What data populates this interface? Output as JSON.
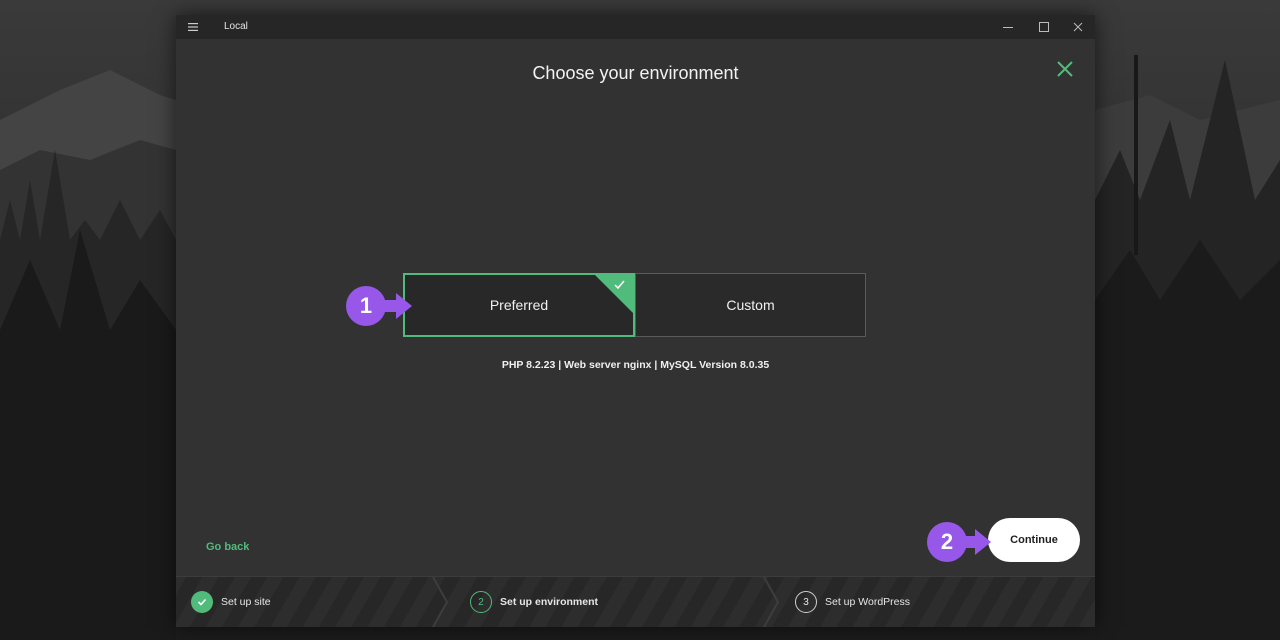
{
  "window": {
    "title": "Local"
  },
  "dialog": {
    "heading": "Choose your environment",
    "options": [
      {
        "label": "Preferred",
        "selected": true
      },
      {
        "label": "Custom",
        "selected": false
      }
    ],
    "details": "PHP 8.2.23 | Web server nginx | MySQL Version 8.0.35",
    "go_back_label": "Go back",
    "continue_label": "Continue"
  },
  "callouts": [
    "1",
    "2"
  ],
  "steps": [
    {
      "number": "",
      "label": "Set up site",
      "state": "done"
    },
    {
      "number": "2",
      "label": "Set up environment",
      "state": "current"
    },
    {
      "number": "3",
      "label": "Set up WordPress",
      "state": "upcoming"
    }
  ],
  "colors": {
    "accent": "#51bb7b",
    "callout": "#9757e8",
    "window_bg": "#323232"
  },
  "icons": [
    "hamburger-menu-icon",
    "minimize-icon",
    "maximize-icon",
    "window-close-icon",
    "close-icon",
    "checkmark-icon",
    "arrow-right-icon"
  ]
}
